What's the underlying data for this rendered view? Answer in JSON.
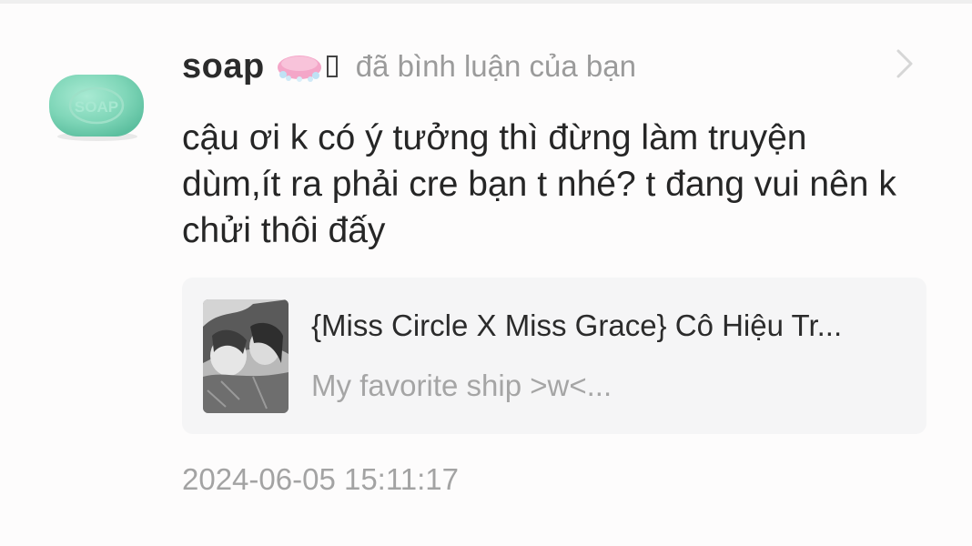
{
  "notification": {
    "username": "soap",
    "action": "đã bình luận của bạn",
    "comment_text": "cậu ơi k có ý tưởng thì đừng làm truyện dùm,ít ra phải cre bạn t nhé? t đang vui nên k chửi thôi đấy",
    "timestamp": "2024-06-05 15:11:17",
    "avatar": {
      "icon": "soap-bar-icon",
      "label": "SOAP"
    },
    "badge_icon": "pink-soap-badge-icon"
  },
  "story": {
    "title": "{Miss Circle X Miss Grace} Cô Hiệu Tr...",
    "description": "My favorite ship >w<..."
  },
  "colors": {
    "background": "#fdfcfc",
    "username": "#2b2b2b",
    "muted_text": "#9b9b9b",
    "card_background": "#f5f5f6",
    "avatar_green": "#7fd6b8",
    "badge_pink": "#f4a6c8"
  }
}
